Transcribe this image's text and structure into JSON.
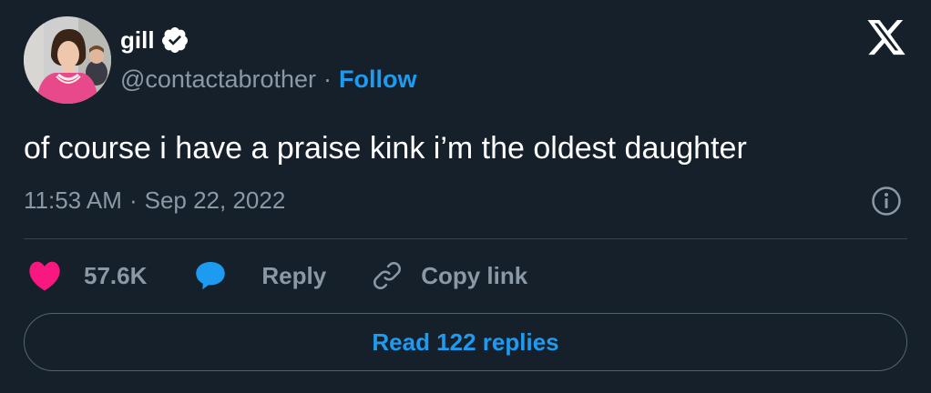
{
  "author": {
    "name": "gill",
    "handle": "@contactabrother",
    "separator": "·",
    "follow_label": "Follow"
  },
  "tweet": {
    "text": "of course i have a praise kink i’m the oldest daughter",
    "time": "11:53 AM",
    "separator": "·",
    "date": "Sep 22, 2022"
  },
  "actions": {
    "like_count": "57.6K",
    "reply_label": "Reply",
    "copy_link_label": "Copy link"
  },
  "footer": {
    "read_replies_label": "Read 122 replies"
  },
  "icons": {
    "verified": "verified-badge-icon",
    "logo": "x-logo-icon",
    "info": "info-icon",
    "like": "heart-icon",
    "reply": "speech-bubble-icon",
    "copy": "link-icon"
  },
  "colors": {
    "background": "#15202b",
    "accent": "#1d9bf0",
    "like": "#f91880",
    "muted": "#8b98a5",
    "text": "#ffffff"
  }
}
